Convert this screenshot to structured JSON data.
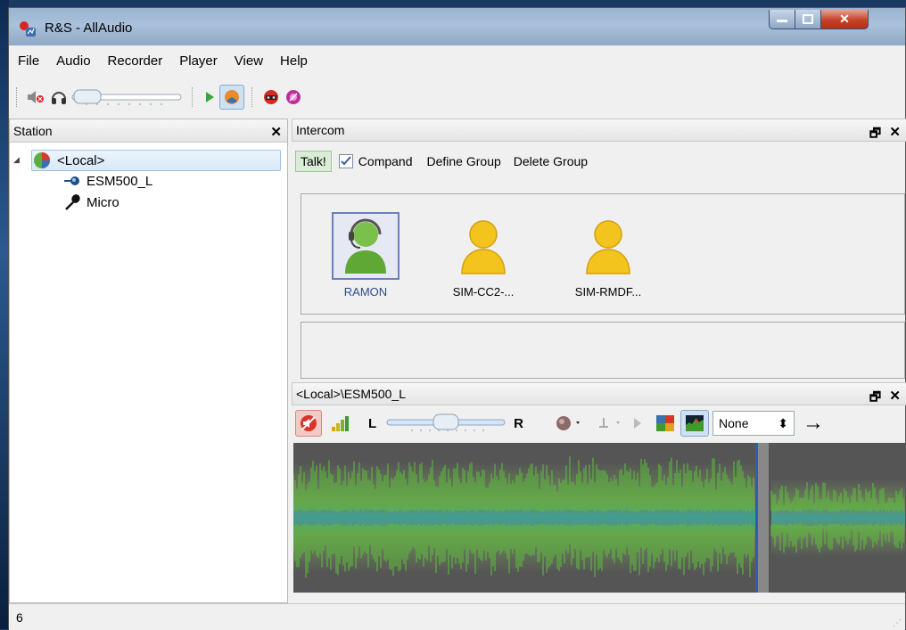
{
  "window": {
    "title": "R&S - AllAudio"
  },
  "menu": [
    "File",
    "Audio",
    "Recorder",
    "Player",
    "View",
    "Help"
  ],
  "station": {
    "title": "Station",
    "tree": [
      {
        "label": "<Local>",
        "level": 0
      },
      {
        "label": "ESM500_L",
        "level": 1
      },
      {
        "label": "Micro",
        "level": 1
      }
    ]
  },
  "intercom": {
    "title": "Intercom",
    "talk_label": "Talk!",
    "compand_label": "Compand",
    "compand_checked": true,
    "define_group_label": "Define Group",
    "delete_group_label": "Delete Group",
    "participants": [
      {
        "name": "RAMON",
        "color": "green",
        "selected": true
      },
      {
        "name": "SIM-CC2-...",
        "color": "yellow",
        "selected": false
      },
      {
        "name": "SIM-RMDF...",
        "color": "yellow",
        "selected": false
      }
    ]
  },
  "player": {
    "title": "<Local>\\ESM500_L",
    "left_label": "L",
    "right_label": "R",
    "select_value": "None"
  },
  "status": {
    "text": "6"
  },
  "colors": {
    "waveform": "#5cc23a",
    "wave_band": "#4fa08a",
    "accent": "#3a6fb0"
  }
}
